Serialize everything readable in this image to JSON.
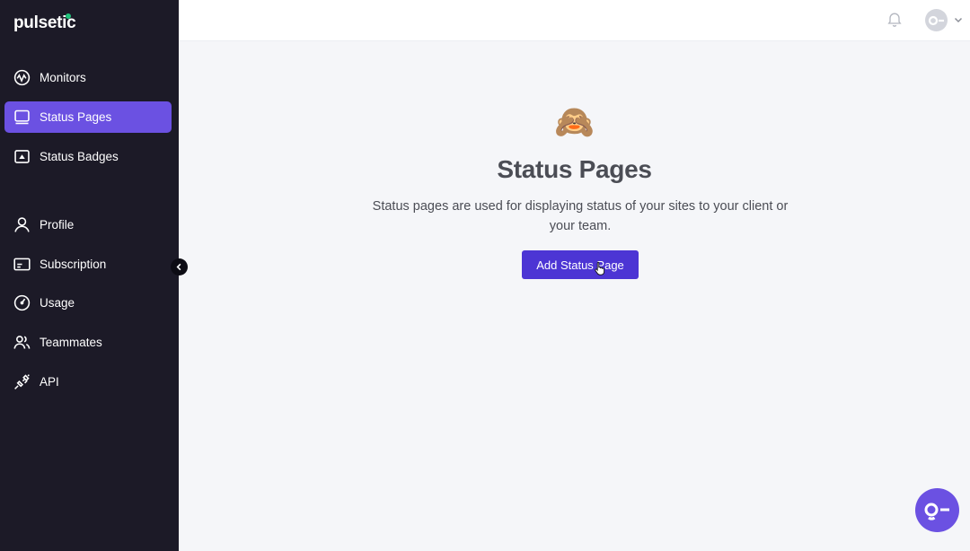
{
  "brand": {
    "name": "pulsetic",
    "accent": "#6b51e2",
    "button": "#4c35d4",
    "dot": "#1fc47b"
  },
  "sidebar": {
    "items": [
      {
        "label": "Monitors",
        "icon": "monitor-pulse-icon"
      },
      {
        "label": "Status Pages",
        "icon": "screen-icon",
        "active": true
      },
      {
        "label": "Status Badges",
        "icon": "badge-icon"
      },
      {
        "label": "Profile",
        "icon": "user-icon"
      },
      {
        "label": "Subscription",
        "icon": "card-icon"
      },
      {
        "label": "Usage",
        "icon": "gauge-icon"
      },
      {
        "label": "Teammates",
        "icon": "users-icon"
      },
      {
        "label": "API",
        "icon": "plug-icon"
      }
    ]
  },
  "header": {
    "icons": [
      "bell-icon",
      "avatar",
      "chevron-down-icon"
    ]
  },
  "main": {
    "emoji": "🙈",
    "title": "Status Pages",
    "description": "Status pages are used for displaying status of your sites to your client or your team.",
    "button_label": "Add Status Page"
  }
}
